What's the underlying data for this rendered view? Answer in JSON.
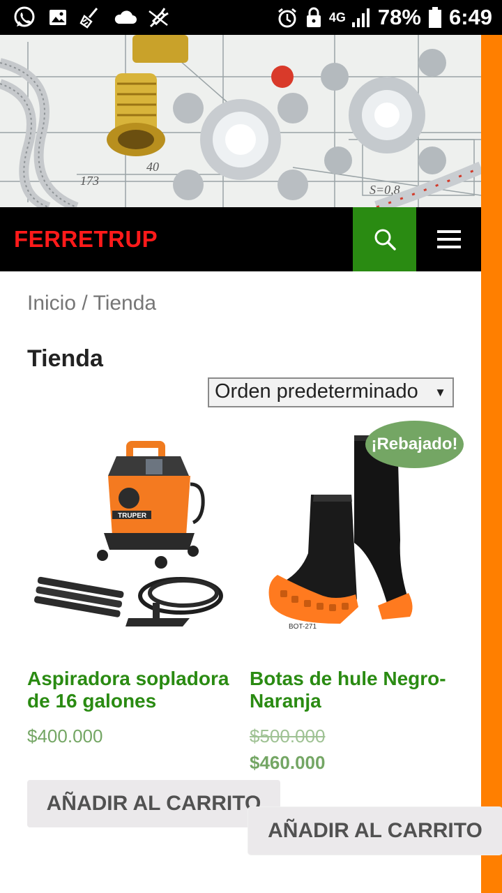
{
  "status_bar": {
    "battery": "78%",
    "time": "6:49",
    "network": "4G",
    "icons": [
      "whatsapp-icon",
      "gallery-icon",
      "broom-icon",
      "cloud-icon",
      "usb-off-icon",
      "alarm-icon",
      "lock-icon",
      "signal-icon",
      "battery-icon"
    ]
  },
  "header": {
    "brand": "FERRETRUP"
  },
  "breadcrumb": "Inicio / Tienda",
  "page_title": "Tienda",
  "sort": {
    "selected": "Orden predeterminado"
  },
  "products": [
    {
      "name": "Aspiradora sopladora de 16 galones",
      "price": "$400.000",
      "button": "AÑADIR AL CARRITO",
      "image_brand": "TRUPER"
    },
    {
      "name": "Botas de hule Negro-Naranja",
      "badge": "¡Rebajado!",
      "old_price": "$500.000",
      "price": "$460.000",
      "button": "AÑADIR AL CARRITO",
      "image_caption": "BOT-271"
    }
  ],
  "colors": {
    "brand_red": "#ff1a1a",
    "accent_green": "#2a8b12",
    "price_green": "#74a664",
    "stripe_orange": "#ff7f00"
  }
}
